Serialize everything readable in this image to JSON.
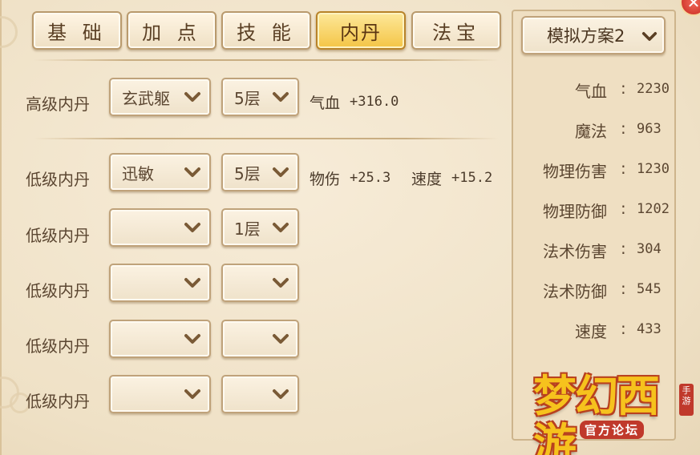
{
  "tabs": [
    {
      "label": "基 础",
      "active": false
    },
    {
      "label": "加 点",
      "active": false
    },
    {
      "label": "技 能",
      "active": false
    },
    {
      "label": "内丹",
      "active": true
    },
    {
      "label": "法宝",
      "active": false
    }
  ],
  "scheme": {
    "label": "模拟方案2"
  },
  "rows": [
    {
      "label": "高级内丹",
      "type": "玄武躯",
      "level": "5层",
      "stats": [
        {
          "name": "气血",
          "value": "+316.0"
        }
      ]
    },
    {
      "label": "低级内丹",
      "type": "迅敏",
      "level": "5层",
      "stats": [
        {
          "name": "物伤",
          "value": "+25.3"
        },
        {
          "name": "速度",
          "value": "+15.2"
        }
      ]
    },
    {
      "label": "低级内丹",
      "type": "",
      "level": "1层",
      "stats": []
    },
    {
      "label": "低级内丹",
      "type": "",
      "level": "",
      "stats": []
    },
    {
      "label": "低级内丹",
      "type": "",
      "level": "",
      "stats": []
    },
    {
      "label": "低级内丹",
      "type": "",
      "level": "",
      "stats": []
    }
  ],
  "attributes": [
    {
      "name": "气血",
      "value": "2230"
    },
    {
      "name": "魔法",
      "value": "963"
    },
    {
      "name": "物理伤害",
      "value": "1230"
    },
    {
      "name": "物理防御",
      "value": "1202"
    },
    {
      "name": "法术伤害",
      "value": "304"
    },
    {
      "name": "法术防御",
      "value": "545"
    },
    {
      "name": "速度",
      "value": "433"
    }
  ],
  "attr_separator": ":",
  "logo": {
    "title": "梦幻西游",
    "subtitle": "官方论坛",
    "tag": "手游"
  },
  "colors": {
    "active_tab": "#f4c546",
    "panel_bg": "#f2e6cf",
    "text": "#5b4631"
  }
}
